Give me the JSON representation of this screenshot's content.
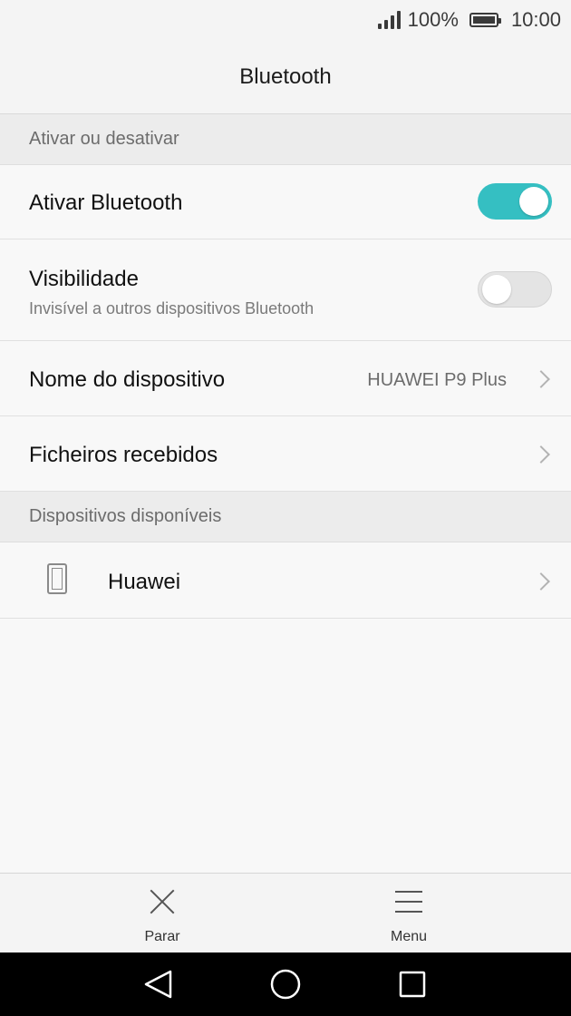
{
  "status_bar": {
    "battery_percent": "100%",
    "time": "10:00",
    "signal_bars": 4
  },
  "title": "Bluetooth",
  "sections": {
    "toggle_header": "Ativar ou desativar",
    "devices_header": "Dispositivos disponíveis"
  },
  "settings": {
    "bluetooth": {
      "label": "Ativar Bluetooth",
      "enabled": true
    },
    "visibility": {
      "label": "Visibilidade",
      "subtitle": "Invisível a outros dispositivos Bluetooth",
      "enabled": false
    },
    "device_name": {
      "label": "Nome do dispositivo",
      "value": "HUAWEI P9 Plus"
    },
    "received_files": {
      "label": "Ficheiros recebidos"
    }
  },
  "devices": [
    {
      "name": "Huawei",
      "icon": "phone-icon"
    }
  ],
  "bottom_actions": {
    "stop_label": "Parar",
    "menu_label": "Menu"
  },
  "colors": {
    "accent": "#35bfc2"
  }
}
